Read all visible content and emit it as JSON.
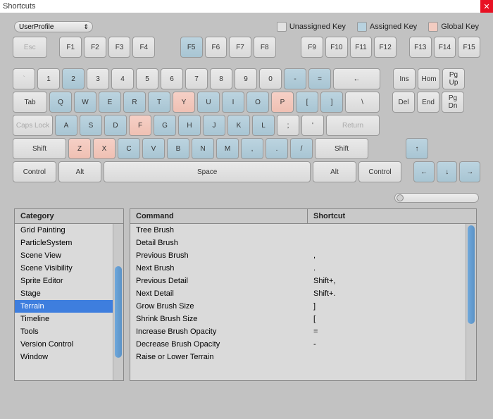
{
  "window": {
    "title": "Shortcuts"
  },
  "profile": {
    "label": "UserProfile"
  },
  "legend": {
    "unassigned": {
      "label": "Unassigned Key",
      "color": "#e2e2e2"
    },
    "assigned": {
      "label": "Assigned Key",
      "color": "#b8d2df"
    },
    "global": {
      "label": "Global Key",
      "color": "#f3ccc1"
    }
  },
  "keys": {
    "row0": [
      "Esc",
      "F1",
      "F2",
      "F3",
      "F4",
      "F5",
      "F6",
      "F7",
      "F8",
      "F9",
      "F10",
      "F11",
      "F12",
      "F13",
      "F14",
      "F15"
    ],
    "row1": [
      "`",
      "1",
      "2",
      "3",
      "4",
      "5",
      "6",
      "7",
      "8",
      "9",
      "0",
      "-",
      "=",
      "←",
      "Ins",
      "Hom",
      "Pg\nUp"
    ],
    "row2": [
      "Tab",
      "Q",
      "W",
      "E",
      "R",
      "T",
      "Y",
      "U",
      "I",
      "O",
      "P",
      "[",
      "]",
      "\\",
      "Del",
      "End",
      "Pg\nDn"
    ],
    "row3": [
      "Caps Lock",
      "A",
      "S",
      "D",
      "F",
      "G",
      "H",
      "J",
      "K",
      "L",
      ";",
      "'",
      "Return"
    ],
    "row4": [
      "Shift",
      "Z",
      "X",
      "C",
      "V",
      "B",
      "N",
      "M",
      ",",
      ".",
      "/",
      "Shift",
      "↑"
    ],
    "row5": [
      "Control",
      "Alt",
      "Space",
      "Alt",
      "Control",
      "←",
      "↓",
      "→"
    ]
  },
  "headers": {
    "category": "Category",
    "command": "Command",
    "shortcut": "Shortcut"
  },
  "categories": [
    {
      "name": "Grid Painting",
      "selected": false
    },
    {
      "name": "ParticleSystem",
      "selected": false
    },
    {
      "name": "Scene View",
      "selected": false
    },
    {
      "name": "Scene Visibility",
      "selected": false
    },
    {
      "name": "Sprite Editor",
      "selected": false
    },
    {
      "name": "Stage",
      "selected": false
    },
    {
      "name": "Terrain",
      "selected": true
    },
    {
      "name": "Timeline",
      "selected": false
    },
    {
      "name": "Tools",
      "selected": false
    },
    {
      "name": "Version Control",
      "selected": false
    },
    {
      "name": "Window",
      "selected": false
    }
  ],
  "commands": [
    {
      "name": "Tree Brush",
      "shortcut": ""
    },
    {
      "name": "Detail Brush",
      "shortcut": ""
    },
    {
      "name": "Previous Brush",
      "shortcut": ","
    },
    {
      "name": "Next Brush",
      "shortcut": "."
    },
    {
      "name": "Previous Detail",
      "shortcut": "Shift+,"
    },
    {
      "name": "Next Detail",
      "shortcut": "Shift+."
    },
    {
      "name": "Grow Brush Size",
      "shortcut": "]"
    },
    {
      "name": "Shrink Brush Size",
      "shortcut": "["
    },
    {
      "name": "Increase Brush Opacity",
      "shortcut": "="
    },
    {
      "name": "Decrease Brush Opacity",
      "shortcut": "-"
    },
    {
      "name": "Raise or Lower Terrain",
      "shortcut": ""
    }
  ],
  "key_states": {
    "assigned": [
      "F5",
      "2",
      "-",
      "=",
      "Q",
      "W",
      "E",
      "R",
      "T",
      "U",
      "I",
      "O",
      "[",
      "]",
      "A",
      "S",
      "D",
      "G",
      "H",
      "J",
      "K",
      "L",
      "C",
      "V",
      "B",
      "N",
      "M",
      ",",
      ".",
      "/",
      "←arrow",
      "↓",
      "→",
      "↑"
    ],
    "global": [
      "Y",
      "P",
      "F",
      "Z",
      "X"
    ],
    "disabled": [
      "Esc",
      "Caps Lock",
      "`",
      "Return"
    ]
  }
}
